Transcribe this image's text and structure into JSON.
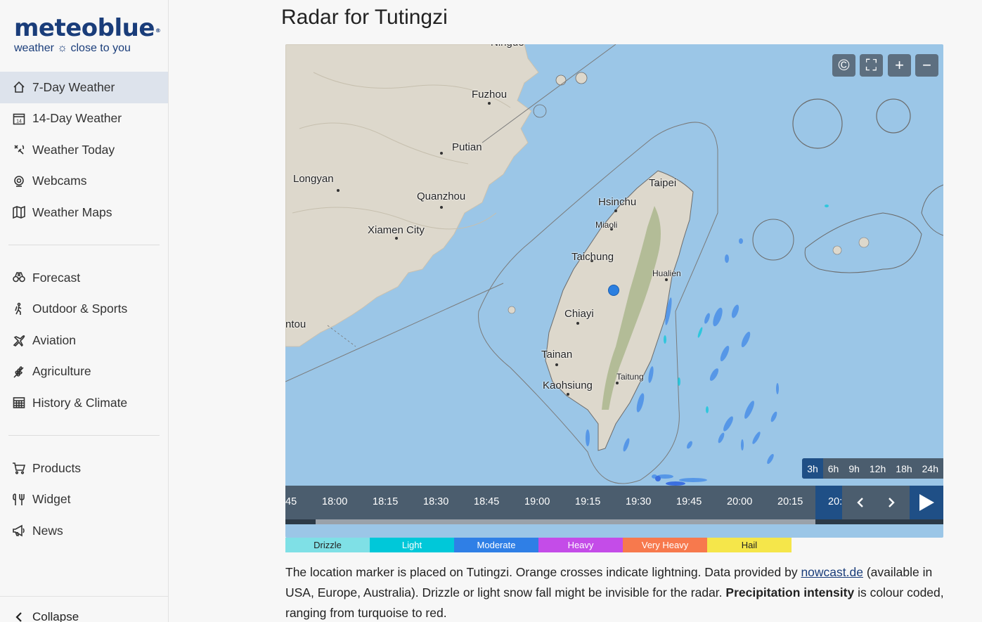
{
  "brand": {
    "name": "meteoblue",
    "reg": "®",
    "tagline_pre": "weather",
    "tagline_post": "close to you"
  },
  "nav_primary": [
    {
      "label": "7-Day Weather",
      "icon": "house-icon",
      "active": true
    },
    {
      "label": "14-Day Weather",
      "icon": "calendar-icon",
      "active": false
    },
    {
      "label": "Weather Today",
      "icon": "satellite-icon",
      "active": false
    },
    {
      "label": "Webcams",
      "icon": "webcam-icon",
      "active": false
    },
    {
      "label": "Weather Maps",
      "icon": "map-icon",
      "active": false
    }
  ],
  "nav_secondary": [
    {
      "label": "Forecast",
      "icon": "binoculars-icon"
    },
    {
      "label": "Outdoor & Sports",
      "icon": "hiker-icon"
    },
    {
      "label": "Aviation",
      "icon": "plane-icon"
    },
    {
      "label": "Agriculture",
      "icon": "wheat-icon"
    },
    {
      "label": "History & Climate",
      "icon": "table-icon"
    }
  ],
  "nav_tertiary": [
    {
      "label": "Products",
      "icon": "cart-icon"
    },
    {
      "label": "Widget",
      "icon": "widget-icon"
    },
    {
      "label": "News",
      "icon": "megaphone-icon"
    }
  ],
  "collapse_label": "Collapse",
  "page_title": "Radar for Tutingzi",
  "map": {
    "controls": [
      "©",
      "⛶",
      "+",
      "−"
    ],
    "cities": [
      {
        "name": "Ningde",
        "cls": ""
      },
      {
        "name": "Fuzhou",
        "cls": ""
      },
      {
        "name": "Putian",
        "cls": ""
      },
      {
        "name": "Longyan",
        "cls": ""
      },
      {
        "name": "Quanzhou",
        "cls": ""
      },
      {
        "name": "Xiamen City",
        "cls": ""
      },
      {
        "name": "ntou",
        "cls": ""
      },
      {
        "name": "Taipei",
        "cls": ""
      },
      {
        "name": "Hsinchu",
        "cls": ""
      },
      {
        "name": "Miaoli",
        "cls": "small"
      },
      {
        "name": "Taichung",
        "cls": ""
      },
      {
        "name": "Hualien",
        "cls": "small"
      },
      {
        "name": "Chiayi",
        "cls": ""
      },
      {
        "name": "Tainan",
        "cls": ""
      },
      {
        "name": "Taitung",
        "cls": "small"
      },
      {
        "name": "Kaohsiung",
        "cls": ""
      }
    ],
    "ranges": [
      "3h",
      "6h",
      "9h",
      "12h",
      "18h",
      "24h"
    ],
    "active_range": "3h"
  },
  "timeline": {
    "ticks": [
      "45",
      "18:00",
      "18:15",
      "18:30",
      "18:45",
      "19:00",
      "19:15",
      "19:30",
      "19:45",
      "20:00",
      "20:15",
      "20:"
    ],
    "progress": 0.046
  },
  "legend": [
    {
      "label": "Drizzle",
      "color": "#7fe0e6",
      "light": false
    },
    {
      "label": "Light",
      "color": "#00c8d9",
      "light": true
    },
    {
      "label": "Moderate",
      "color": "#2f7fe6",
      "light": true
    },
    {
      "label": "Heavy",
      "color": "#c44ce8",
      "light": true
    },
    {
      "label": "Very Heavy",
      "color": "#f7794d",
      "light": true
    },
    {
      "label": "Hail",
      "color": "#f5e64a",
      "light": false
    }
  ],
  "description": {
    "p1": "The location marker is placed on Tutingzi. Orange crosses indicate lightning. Data provided by ",
    "link": "nowcast.de",
    "p2": " (available in USA, Europe, Australia). Drizzle or light snow fall might be invisible for the radar. ",
    "bold": "Precipitation intensity",
    "p3": " is colour coded, ranging from turquoise to red."
  }
}
